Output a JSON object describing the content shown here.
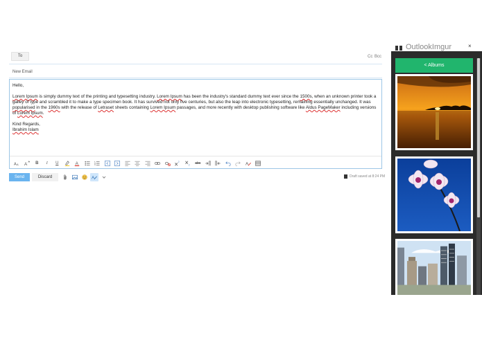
{
  "compose": {
    "to_label": "To",
    "cc_label": "Cc",
    "bcc_label": "Bcc",
    "subject_placeholder": "New Email",
    "body": {
      "greeting": "Hello,",
      "p1_a": "Lorem Ipsum",
      "p1_b": " is simply dummy text of the printing and typesetting industry. ",
      "p1_c": "Lorem Ipsum",
      "p1_d": " has been the industry's standard dummy text ever since the ",
      "p1_e": "1500s",
      "p1_f": ", when an unknown printer took a galley of type and scrambled it to make a type specimen book. It has survived not only five centuries, but also the leap into electronic typesetting, remaining essentially unchanged. It was ",
      "p1_g": "popularised",
      "p1_h": " in the ",
      "p1_i": "1960s",
      "p1_j": " with the release of ",
      "p1_k": "Letraset",
      "p1_l": " sheets containing ",
      "p1_m": "Lorem Ipsum",
      "p1_n": " passages, and more recently with desktop publishing software like ",
      "p1_o": "Aldus PageMaker",
      "p1_p": " including versions of ",
      "p1_q": "Lorem Ipsum",
      "p1_r": ".",
      "closing": "Kind Regards,",
      "signature": "Ibrahim Islam"
    },
    "format_toolbar": [
      "font-size-icon",
      "grow-font-icon",
      "bold-icon",
      "italic-icon",
      "underline-icon",
      "highlight-icon",
      "font-color-icon",
      "bullets-icon",
      "numbering-icon",
      "decrease-indent-icon",
      "increase-indent-icon",
      "align-left-icon",
      "align-center-icon",
      "align-right-icon",
      "link-icon",
      "unlink-icon",
      "superscript-icon",
      "subscript-icon",
      "strikethrough-icon",
      "ltr-icon",
      "rtl-icon",
      "undo-icon",
      "redo-icon",
      "clear-format-icon",
      "table-icon"
    ],
    "toolbar_text": {
      "bold": "B",
      "italic": "I",
      "underline": "U",
      "strikethrough": "abc"
    },
    "send_label": "Send",
    "discard_label": "Discard",
    "draft_status": "Draft saved at 8:24 PM"
  },
  "addin": {
    "title": "OutlookImgur",
    "close": "×",
    "albums_button": "< Albums",
    "thumbnails": [
      "sunset-photo",
      "orchid-photo",
      "city-photo"
    ]
  },
  "colors": {
    "accent": "#21b56d",
    "send": "#6ab4ef",
    "pane_bg": "#2b2b2b"
  }
}
